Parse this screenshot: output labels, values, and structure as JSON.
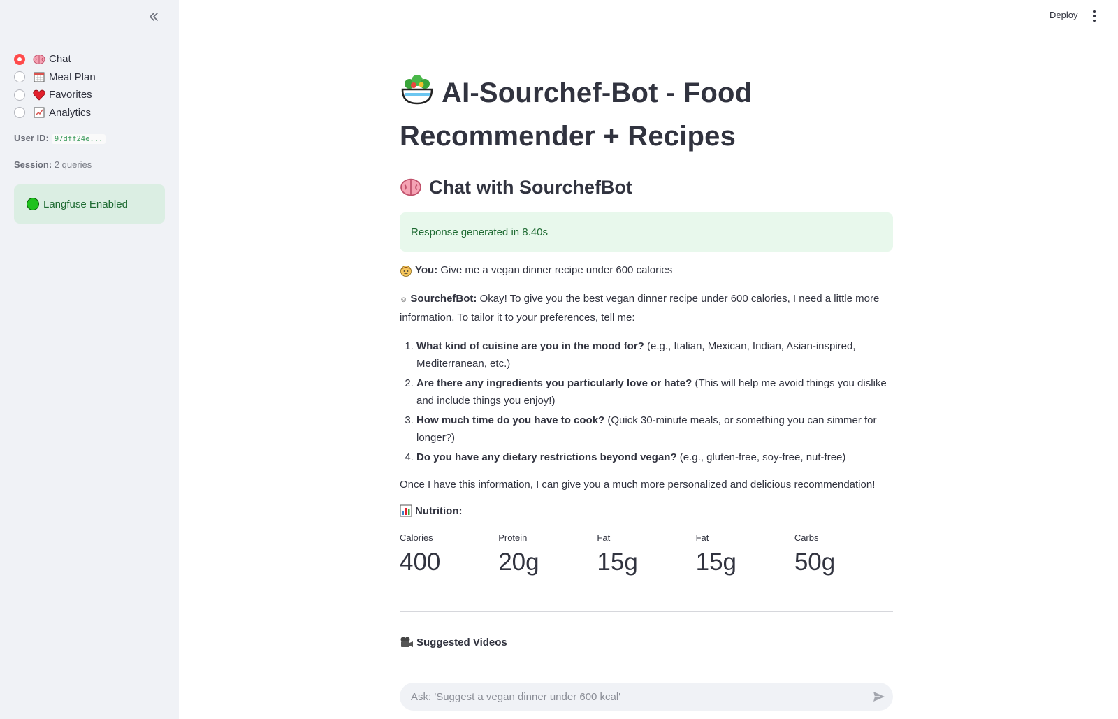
{
  "sidebar": {
    "collapse_icon": "double-chevron-left-icon",
    "nav": [
      {
        "label": "Chat",
        "icon": "brain-icon",
        "selected": true
      },
      {
        "label": "Meal Plan",
        "icon": "calendar-icon",
        "selected": false
      },
      {
        "label": "Favorites",
        "icon": "heart-icon",
        "selected": false
      },
      {
        "label": "Analytics",
        "icon": "chart-increasing-icon",
        "selected": false
      }
    ],
    "user_id_label": "User ID:",
    "user_id_value": "97dff24e...",
    "session_label": "Session:",
    "session_value": "2 queries",
    "langfuse_status": "Langfuse Enabled"
  },
  "header": {
    "deploy_label": "Deploy"
  },
  "main": {
    "title": "AI-Sourchef-Bot - Food Recommender + Recipes",
    "subheader": "Chat with SourchefBot",
    "success_message": "Response generated in 8.40s",
    "user_label": "You:",
    "user_message": "Give me a vegan dinner recipe under 600 calories",
    "bot_label": "SourchefBot:",
    "bot_intro": "Okay! To give you the best vegan dinner recipe under 600 calories, I need a little more information. To tailor it to your preferences, tell me:",
    "questions": [
      {
        "bold": "What kind of cuisine are you in the mood for?",
        "rest": "(e.g., Italian, Mexican, Indian, Asian-inspired, Mediterranean, etc.)"
      },
      {
        "bold": "Are there any ingredients you particularly love or hate?",
        "rest": "(This will help me avoid things you dislike and include things you enjoy!)"
      },
      {
        "bold": "How much time do you have to cook?",
        "rest": "(Quick 30-minute meals, or something you can simmer for longer?)"
      },
      {
        "bold": "Do you have any dietary restrictions beyond vegan?",
        "rest": "(e.g., gluten-free, soy-free, nut-free)"
      }
    ],
    "bot_closing": "Once I have this information, I can give you a much more personalized and delicious recommendation!",
    "nutrition_heading": "Nutrition:",
    "metrics": [
      {
        "label": "Calories",
        "value": "400"
      },
      {
        "label": "Protein",
        "value": "20g"
      },
      {
        "label": "Fat",
        "value": "15g"
      },
      {
        "label": "Fat",
        "value": "15g"
      },
      {
        "label": "Carbs",
        "value": "50g"
      }
    ],
    "videos_heading": "Suggested Videos"
  },
  "chat_input": {
    "placeholder": "Ask: 'Suggest a vegan dinner under 600 kcal'"
  },
  "colors": {
    "accent": "#ff4b4b",
    "sidebar_bg": "#f0f2f6",
    "success_bg": "#e8f8ec",
    "success_text": "#1f6b33"
  }
}
